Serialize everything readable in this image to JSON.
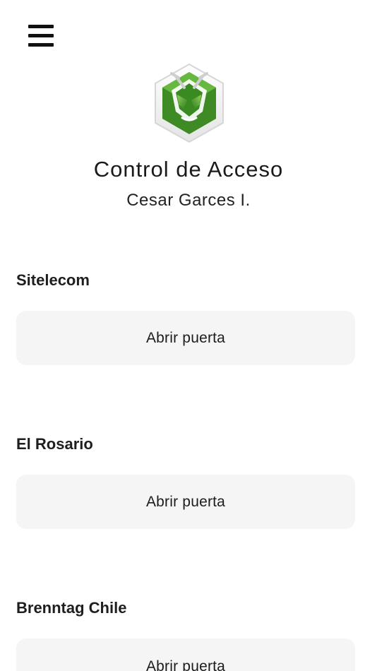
{
  "app": {
    "title": "Control de Acceso",
    "user_name": "Cesar Garces I.",
    "menu_icon": "hamburger-menu-icon",
    "logo_icon": "ant-hexagon-logo-icon",
    "brand_green": "#4c9a2a"
  },
  "sites": [
    {
      "name": "Sitelecom",
      "button_label": "Abrir puerta"
    },
    {
      "name": "El Rosario",
      "button_label": "Abrir puerta"
    },
    {
      "name": "Brenntag Chile",
      "button_label": "Abrir puerta"
    }
  ]
}
